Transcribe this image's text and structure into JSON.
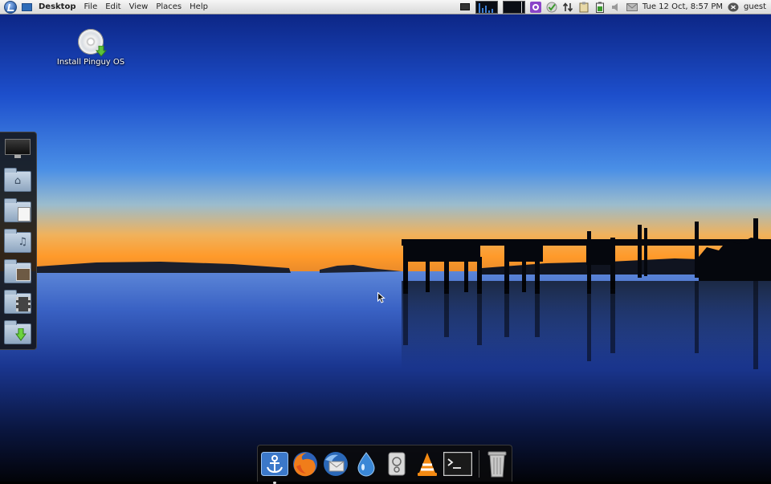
{
  "top_panel": {
    "app_title": "Desktop",
    "menus": [
      "File",
      "Edit",
      "View",
      "Places",
      "Help"
    ],
    "clock": "Tue 12 Oct,  8:57 PM",
    "user": "guest",
    "tray_icons": [
      "system-monitor-graph",
      "applet-gear-icon",
      "update-check-icon",
      "network-arrows-icon",
      "clipboard-icon",
      "battery-icon",
      "volume-icon",
      "mail-icon"
    ]
  },
  "desktop": {
    "install_icon_label": "Install Pinguy OS"
  },
  "left_dock": {
    "items": [
      "monitor-icon",
      "home-folder-icon",
      "documents-folder-icon",
      "music-folder-icon",
      "pictures-folder-icon",
      "videos-folder-icon",
      "downloads-folder-icon"
    ]
  },
  "bottom_dock": {
    "items": [
      "docky-anchor-icon",
      "firefox-icon",
      "thunderbird-icon",
      "deluge-icon",
      "disk-utility-icon",
      "vlc-icon",
      "terminal-icon",
      "trash-icon"
    ]
  },
  "colors": {
    "sky_top": "#0b2a8c",
    "sky_mid": "#2f74e0",
    "horizon": "#f59a2c",
    "water": "#12205a",
    "panel": "#e9e9e9"
  }
}
